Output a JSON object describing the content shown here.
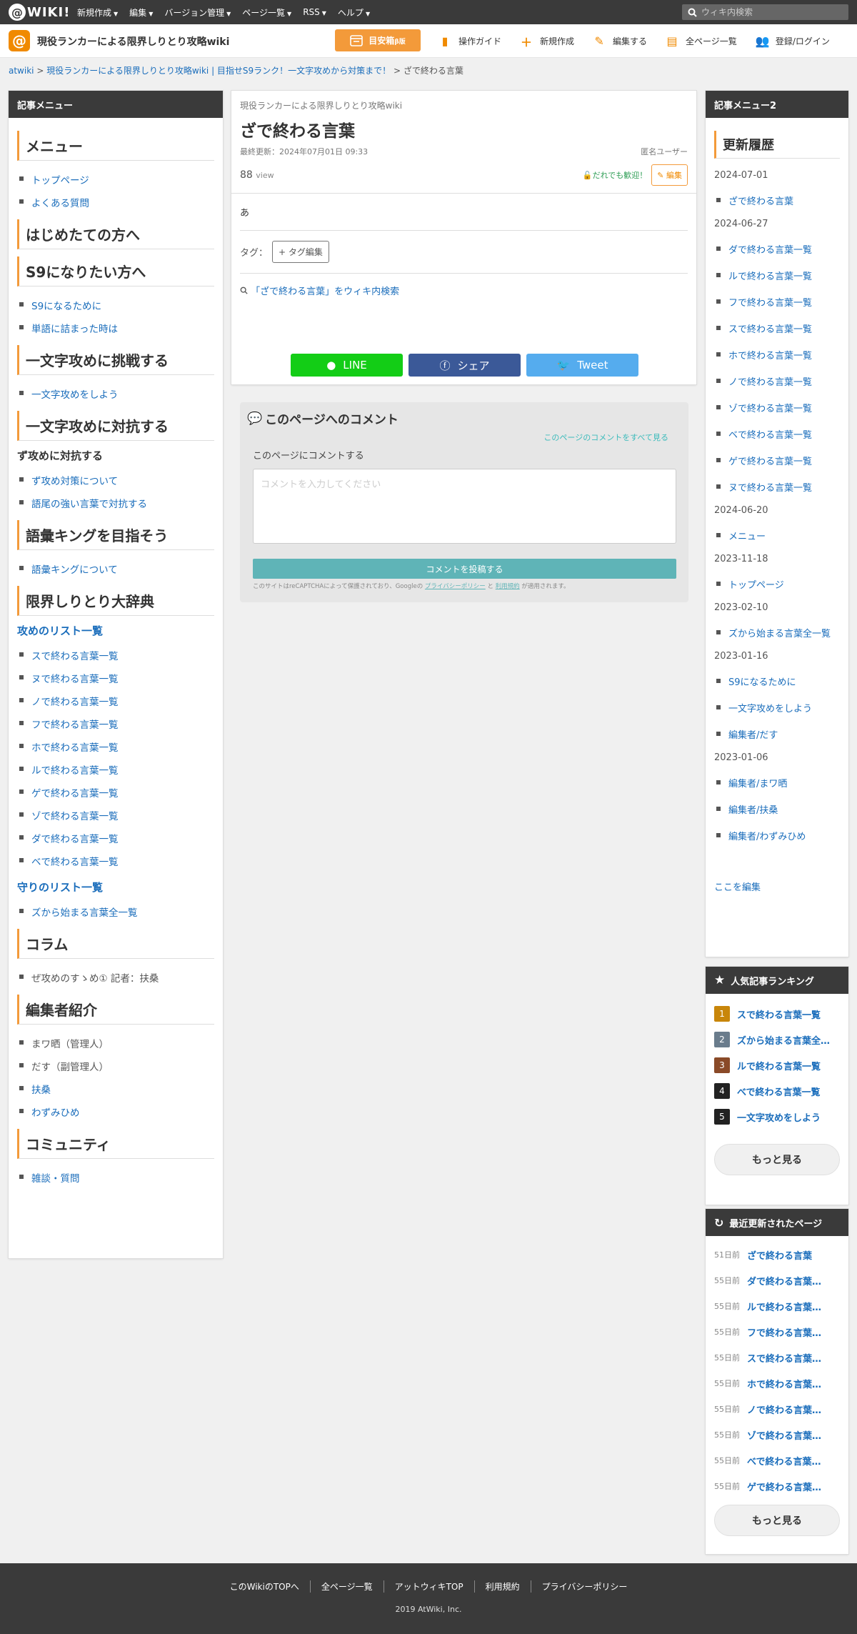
{
  "topbar": {
    "logo_text": "WIKI!",
    "menus": [
      "新規作成",
      "編集",
      "バージョン管理",
      "ページ一覧",
      "RSS",
      "ヘルプ"
    ],
    "search_placeholder": "ウィキ内検索"
  },
  "site": {
    "title": "現役ランカーによる限界しりとり攻略wiki",
    "mokuji_label": "目安箱",
    "mokuji_sub": "β版",
    "nav": [
      {
        "label": "操作ガイド",
        "icon": "guide-icon"
      },
      {
        "label": "新規作成",
        "icon": "plus-icon"
      },
      {
        "label": "編集する",
        "icon": "pencil-icon"
      },
      {
        "label": "全ページ一覧",
        "icon": "pages-icon"
      },
      {
        "label": "登録/ログイン",
        "icon": "users-icon"
      }
    ]
  },
  "breadcrumb": {
    "items": [
      "atwiki",
      "現役ランカーによる限界しりとり攻略wiki | 目指せS9ランク！一文字攻めから対策まで！",
      "ざで終わる言葉"
    ],
    "sep": " > "
  },
  "left": {
    "header": "記事メニュー",
    "sections": {
      "menu": {
        "title": "メニュー",
        "items": [
          "トップページ",
          "よくある質問"
        ]
      },
      "beginners": {
        "title": "はじめたての方へ"
      },
      "s9": {
        "title": "S9になりたい方へ",
        "items": [
          "S9になるために",
          "単語に詰まった時は"
        ]
      },
      "challenge": {
        "title": "一文字攻めに挑戦する",
        "items": [
          "一文字攻めをしよう"
        ]
      },
      "counter": {
        "title": "一文字攻めに対抗する",
        "sub": "ず攻めに対抗する",
        "items": [
          "ず攻め対策について",
          "語尾の強い言葉で対抗する"
        ]
      },
      "king": {
        "title": "語彙キングを目指そう",
        "items": [
          "語彙キングについて"
        ]
      },
      "dict": {
        "title": "限界しりとり大辞典",
        "attack_title": "攻めのリスト一覧",
        "attack": [
          "スで終わる言葉一覧",
          "ヌで終わる言葉一覧",
          "ノで終わる言葉一覧",
          "フで終わる言葉一覧",
          "ホで終わる言葉一覧",
          "ルで終わる言葉一覧",
          "ゲで終わる言葉一覧",
          "ゾで終わる言葉一覧",
          "ダで終わる言葉一覧",
          "ベで終わる言葉一覧"
        ],
        "defense_title": "守りのリスト一覧",
        "defense": [
          "ズから始まる言葉全一覧"
        ]
      },
      "column": {
        "title": "コラム",
        "item": "ぜ攻めのすゝめ① 記者：扶桑"
      },
      "editors": {
        "title": "編集者紹介",
        "items": [
          "まワ晒（管理人）",
          "だす（副管理人）",
          "扶桑",
          "わずみひめ"
        ]
      },
      "community": {
        "title": "コミュニティ",
        "items": [
          "雑談・質問"
        ]
      }
    }
  },
  "main": {
    "wiki_name": "現役ランカーによる限界しりとり攻略wiki",
    "title": "ざで終わる言葉",
    "updated": "最終更新：2024年07月01日 09:33",
    "user": "匿名ユーザー",
    "views_num": "88",
    "views_unit": "view",
    "welcome": "だれでも歓迎！",
    "edit": "編集",
    "body": "あ",
    "tag_label": "タグ：",
    "tag_button": "+ タグ編集",
    "wiki_search": "「ざで終わる言葉」をウィキ内検索",
    "share": {
      "line": "LINE",
      "fb": "シェア",
      "tw": "Tweet"
    }
  },
  "comments": {
    "title": "このページへのコメント",
    "see_all": "このページのコメントをすべて見る",
    "label": "このページにコメントする",
    "placeholder": "コメントを入力してください",
    "post": "コメントを投稿する",
    "recaptcha_prefix": "このサイトはreCAPTCHAによって保護されており、Googleの",
    "privacy": "プライバシーポリシー",
    "and": "と",
    "terms": "利用規約",
    "recaptcha_suffix": "が適用されます。"
  },
  "right": {
    "header": "記事メニュー2",
    "history_title": "更新履歴",
    "history": [
      {
        "date": "2024-07-01",
        "items": [
          "ざで終わる言葉"
        ]
      },
      {
        "date": "2024-06-27",
        "items": [
          "ダで終わる言葉一覧",
          "ルで終わる言葉一覧",
          "フで終わる言葉一覧",
          "スで終わる言葉一覧",
          "ホで終わる言葉一覧",
          "ノで終わる言葉一覧",
          "ゾで終わる言葉一覧",
          "ベで終わる言葉一覧",
          "ゲで終わる言葉一覧",
          "ヌで終わる言葉一覧"
        ]
      },
      {
        "date": "2024-06-20",
        "items": [
          "メニュー"
        ]
      },
      {
        "date": "2023-11-18",
        "items": [
          "トップページ"
        ]
      },
      {
        "date": "2023-02-10",
        "items": [
          "ズから始まる言葉全一覧"
        ]
      },
      {
        "date": "2023-01-16",
        "items": [
          "S9になるために",
          "一文字攻めをしよう",
          "編集者/だす"
        ]
      },
      {
        "date": "2023-01-06",
        "items": [
          "編集者/まワ晒",
          "編集者/扶桑",
          "編集者/わずみひめ"
        ]
      }
    ],
    "edit_here": "ここを編集"
  },
  "ranking": {
    "header": "人気記事ランキング",
    "items": [
      {
        "n": "1",
        "t": "スで終わる言葉一覧",
        "color": "#c8860a"
      },
      {
        "n": "2",
        "t": "ズから始まる言葉全一覧",
        "color": "#6a7c8c"
      },
      {
        "n": "3",
        "t": "ルで終わる言葉一覧",
        "color": "#8a4a28"
      },
      {
        "n": "4",
        "t": "べで終わる言葉一覧",
        "color": "#222222"
      },
      {
        "n": "5",
        "t": "一文字攻めをしよう",
        "color": "#222222"
      }
    ],
    "more": "もっと見る"
  },
  "recent": {
    "header": "最近更新されたページ",
    "items": [
      {
        "d": "51日前",
        "t": "ざで終わる言葉"
      },
      {
        "d": "55日前",
        "t": "ダで終わる言葉一覧"
      },
      {
        "d": "55日前",
        "t": "ルで終わる言葉一覧"
      },
      {
        "d": "55日前",
        "t": "フで終わる言葉一覧"
      },
      {
        "d": "55日前",
        "t": "スで終わる言葉一覧"
      },
      {
        "d": "55日前",
        "t": "ホで終わる言葉一覧"
      },
      {
        "d": "55日前",
        "t": "ノで終わる言葉一覧"
      },
      {
        "d": "55日前",
        "t": "ゾで終わる言葉一覧"
      },
      {
        "d": "55日前",
        "t": "べで終わる言葉一覧"
      },
      {
        "d": "55日前",
        "t": "ゲで終わる言葉一覧"
      }
    ],
    "more": "もっと見る"
  },
  "footer": {
    "links": [
      "このWikiのTOPへ",
      "全ページ一覧",
      "アットウィキTOP",
      "利用規約",
      "プライバシーポリシー"
    ],
    "copyright": "2019 AtWiki, Inc."
  },
  "colors": {
    "accent": "#f39a3a",
    "link": "#1a6dbb",
    "dark": "#3a3a3a"
  }
}
